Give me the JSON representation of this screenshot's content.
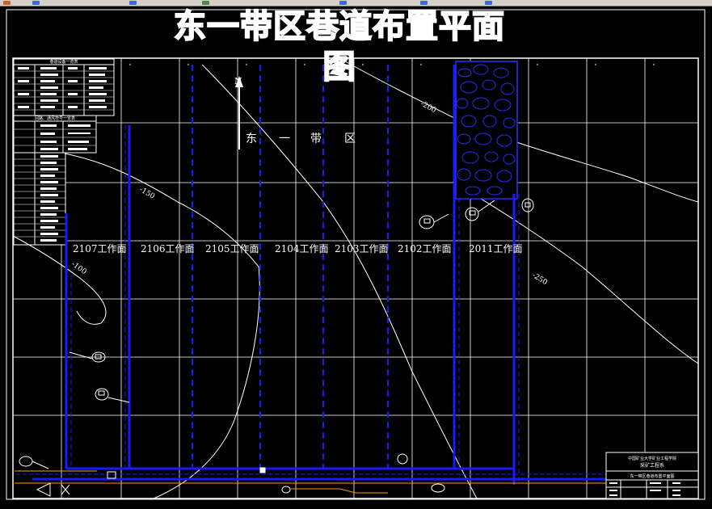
{
  "drawing": {
    "title": "东一带区巷道布置平面图",
    "area_label_chars": [
      "东",
      "一",
      "带",
      "区"
    ],
    "north_label": "N",
    "working_faces": [
      "2107工作面",
      "2106工作面",
      "2105工作面",
      "2104工作面",
      "2103工作面",
      "2102工作面",
      "2011工作面"
    ],
    "contours": [
      "-100",
      "-150",
      "-200",
      "-250"
    ],
    "legend_top_title": "巷道设备一览表",
    "legend_mid_title": "回路、通风符号一览表",
    "title_block": {
      "org_line1": "中国矿业大学矿业工程学院",
      "org_line2": "采矿工程系",
      "drawing_name": "东一带区巷道布置平面图"
    }
  },
  "colors": {
    "background": "#000000",
    "grid": "#ffffff",
    "roadway": "#1a1aff",
    "coal_pillar_hatch": "#2a2aff",
    "conveyor": "#ff9900",
    "toolbar": "#d4d0c8"
  }
}
